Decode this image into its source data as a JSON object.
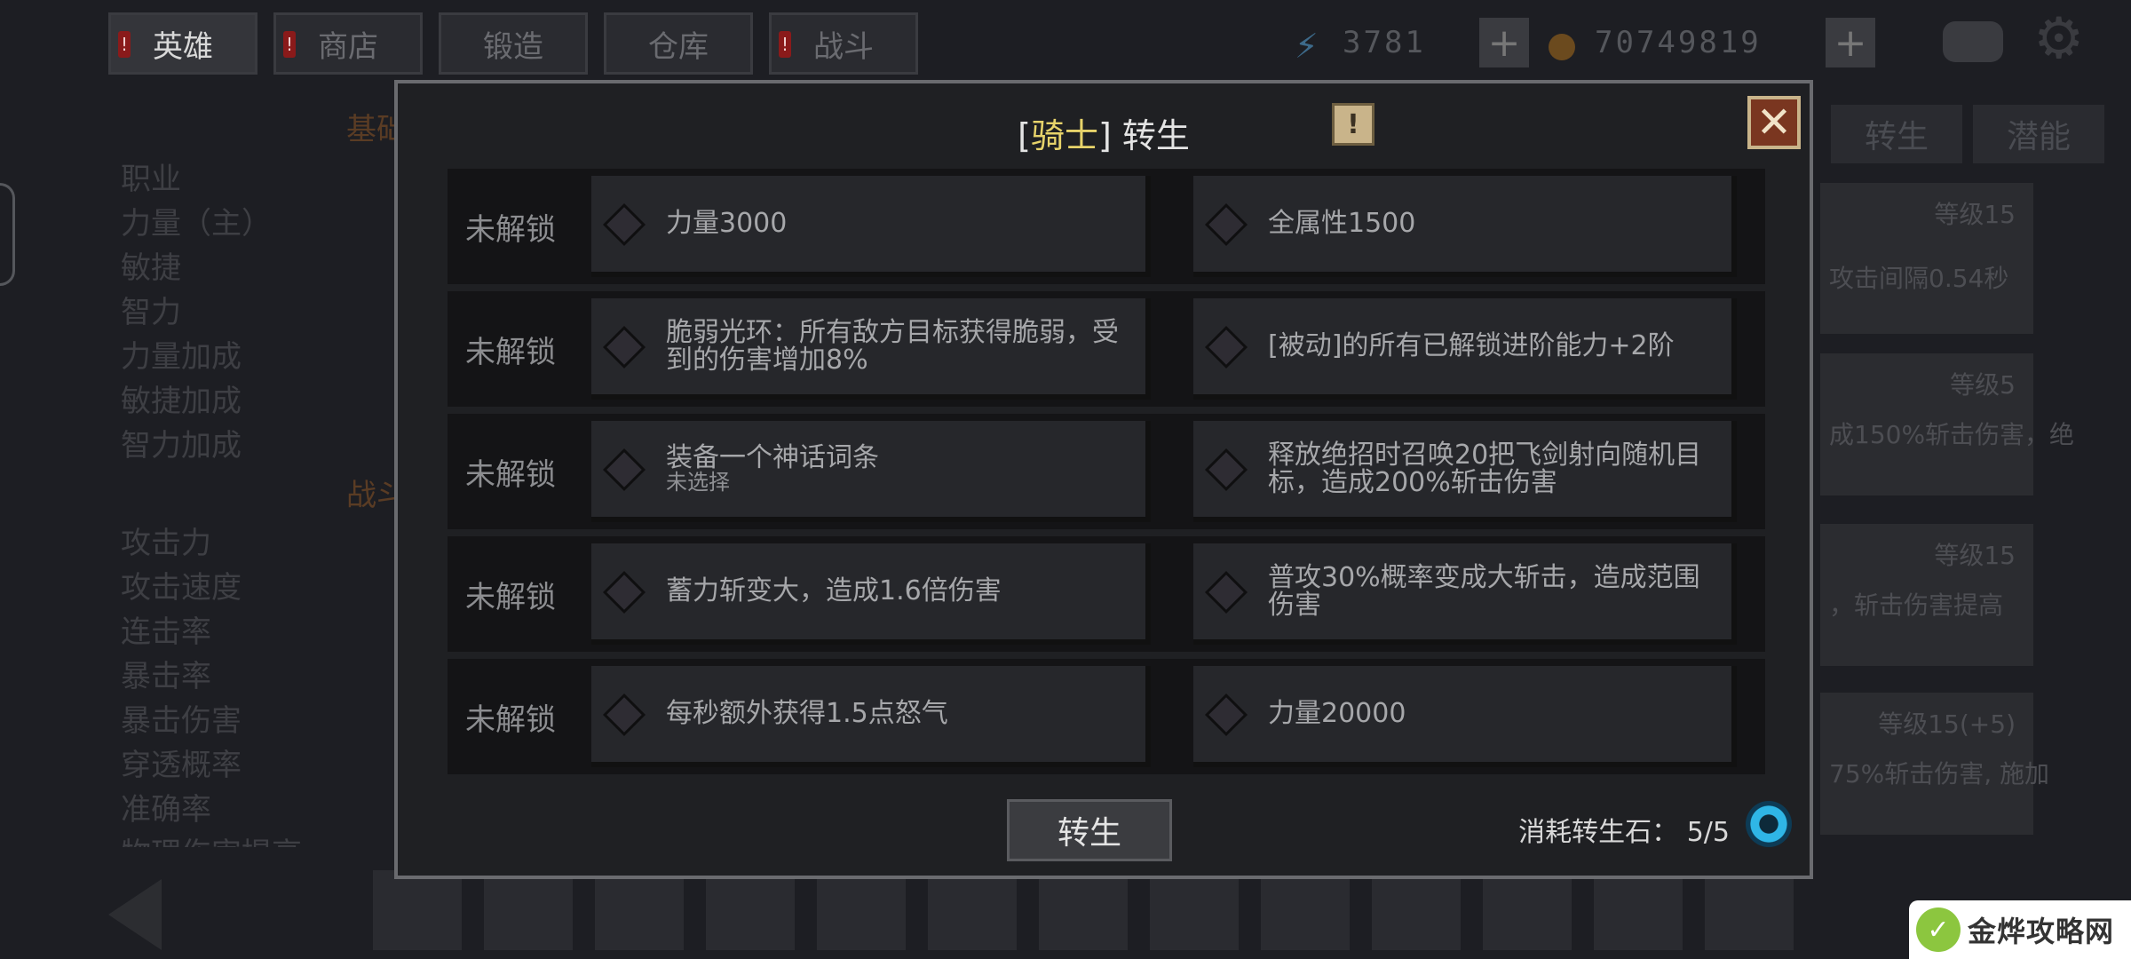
{
  "top_tabs": [
    {
      "label": "英雄",
      "active": true,
      "alert": true
    },
    {
      "label": "商店",
      "active": false,
      "alert": true
    },
    {
      "label": "锻造",
      "active": false,
      "alert": false
    },
    {
      "label": "仓库",
      "active": false,
      "alert": false
    },
    {
      "label": "战斗",
      "active": false,
      "alert": true
    }
  ],
  "resources": {
    "energy": "3781",
    "gold": "70749819"
  },
  "bg_sections": {
    "basic": "基础",
    "battle": "战斗"
  },
  "bg_stats": [
    "职业",
    "力量（主）",
    "敏捷",
    "智力",
    "力量加成",
    "敏捷加成",
    "智力加成",
    "攻击力",
    "攻击速度",
    "连击率",
    "暴击率",
    "暴击伤害",
    "穿透概率",
    "准确率",
    "物理伤害提高"
  ],
  "right_tabs": [
    "转生",
    "潜能"
  ],
  "right_cards": [
    {
      "level": "等级15",
      "text": "攻击间隔0.54秒"
    },
    {
      "level": "等级5",
      "text": "成150%斩击伤害，绝"
    },
    {
      "level": "等级15",
      "text": "，斩击伤害提高"
    },
    {
      "level": "等级15(+5)",
      "text": "75%斩击伤害, 施加"
    }
  ],
  "modal": {
    "title_bracket_open": "[",
    "class_name": "骑士",
    "title_bracket_close": "]",
    "title_suffix": "转生",
    "help_icon": "!",
    "close_icon": "✕",
    "rows": [
      {
        "lock": "未解锁",
        "left": {
          "text": "力量3000",
          "sub": ""
        },
        "right": {
          "text": "全属性1500",
          "sub": ""
        }
      },
      {
        "lock": "未解锁",
        "left": {
          "text": "脆弱光环：所有敌方目标获得脆弱，受到的伤害增加8%",
          "sub": ""
        },
        "right": {
          "text": "[被动]的所有已解锁进阶能力+2阶",
          "sub": ""
        }
      },
      {
        "lock": "未解锁",
        "left": {
          "text": "装备一个神话词条",
          "sub": "未选择"
        },
        "right": {
          "text": "释放绝招时召唤20把飞剑射向随机目标，造成200%斩击伤害",
          "sub": ""
        }
      },
      {
        "lock": "未解锁",
        "left": {
          "text": "蓄力斩变大，造成1.6倍伤害",
          "sub": ""
        },
        "right": {
          "text": "普攻30%概率变成大斩击，造成范围伤害",
          "sub": ""
        }
      },
      {
        "lock": "未解锁",
        "left": {
          "text": "每秒额外获得1.5点怒气",
          "sub": ""
        },
        "right": {
          "text": "力量20000",
          "sub": ""
        }
      }
    ],
    "rebirth_button": "转生",
    "cost_label": "消耗转生石：",
    "cost_value": "5/5"
  },
  "watermark": {
    "text": "金烨攻略网"
  },
  "colors": {
    "class_name": "#e7d36a",
    "close_bg": "#7a3620",
    "gem": "#2fb6e6"
  }
}
